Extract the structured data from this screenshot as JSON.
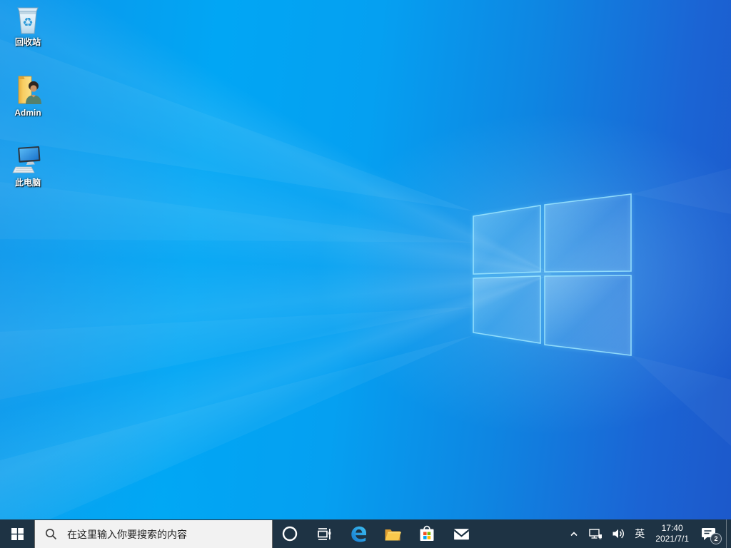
{
  "desktop": {
    "icons": [
      {
        "name": "recycle-bin",
        "label": "回收站"
      },
      {
        "name": "admin-folder",
        "label": "Admin"
      },
      {
        "name": "this-pc",
        "label": "此电脑"
      }
    ]
  },
  "taskbar": {
    "search": {
      "placeholder": "在这里输入你要搜索的内容",
      "icon": "search-icon"
    },
    "start_icon": "windows-logo-icon",
    "app_icons": [
      "cortana-icon",
      "task-view-icon",
      "edge-icon",
      "file-explorer-icon",
      "store-icon",
      "mail-icon"
    ],
    "tray": {
      "hidden_icons_icon": "chevron-up-icon",
      "network_icon": "network-ethernet-icon",
      "volume_icon": "speaker-icon",
      "language": "英",
      "time": "17:40",
      "date": "2021/7/1",
      "action_center_icon": "notification-bubble-icon",
      "notification_count": "2"
    }
  },
  "colors": {
    "taskbar": "#1e3344",
    "search_box": "#f2f2f2",
    "wallpaper_azure": "#01a6f4",
    "wallpaper_deep_blue": "#1c58ca",
    "logo_glow": "#9fe8ff"
  }
}
